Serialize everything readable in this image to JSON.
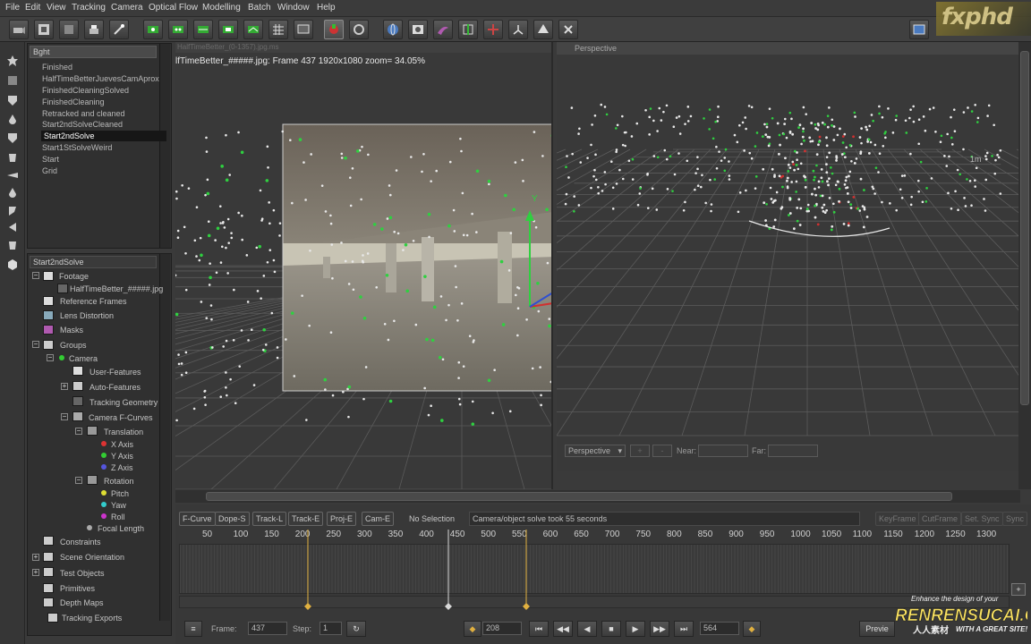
{
  "menu": [
    "File",
    "Edit",
    "View",
    "Tracking",
    "Camera",
    "Optical Flow",
    "Modelling",
    "Batch",
    "Window",
    "Help"
  ],
  "logo": "fxphd",
  "list_panel": {
    "header": "Bght",
    "items": [
      "Finished",
      "HalfTimeBetterJuevesCamAprox",
      "FinishedCleaningSolved",
      "FinishedCleaning",
      "Retracked and cleaned",
      "Start2ndSolveCleaned",
      "Start2ndSolve",
      "Start1StSolveWeird",
      "Start",
      "Grid"
    ],
    "selected": "Start2ndSolve"
  },
  "tree_panel": {
    "header": "Start2ndSolve",
    "items": {
      "footage": "Footage",
      "footage_file": "HalfTimeBetter_#####.jpg",
      "reference_frames": "Reference Frames",
      "lens_distortion": "Lens Distortion",
      "masks": "Masks",
      "groups": "Groups",
      "camera": "Camera",
      "user_features": "User-Features",
      "auto_features": "Auto-Features",
      "tracking_geometry": "Tracking Geometry",
      "camera_fcurves": "Camera F-Curves",
      "translation": "Translation",
      "x_axis": "X Axis",
      "y_axis": "Y Axis",
      "z_axis": "Z Axis",
      "rotation": "Rotation",
      "pitch": "Pitch",
      "yaw": "Yaw",
      "roll": "Roll",
      "focal_length": "Focal Length",
      "constraints": "Constraints",
      "scene_orientation": "Scene Orientation",
      "test_objects": "Test Objects",
      "primitives": "Primitives",
      "depth_maps": "Depth Maps",
      "tracking_exports": "Tracking Exports"
    }
  },
  "left_view": {
    "tab_title": "HalfTimeBetter_(0-1357).jpg.ms",
    "info": "lfTimeBetter_#####.jpg: Frame 437  1920x1080 zoom= 34.05%",
    "axis_label": "Y"
  },
  "right_view": {
    "title": "Perspective",
    "dropdown": "Perspective",
    "plus": "+",
    "minus": "-",
    "near_label": "Near:",
    "far_label": "Far:",
    "near_value": "",
    "far_value": "",
    "axis_label": "1m"
  },
  "timeline": {
    "buttons": [
      "F-Curve",
      "Dope-S",
      "Track-L",
      "Track-E",
      "Proj-E",
      "Cam-E"
    ],
    "selection": "No Selection",
    "solve_info": "Camera/object solve took 55 seconds",
    "right_buttons": [
      "KeyFrame",
      "CutFrame",
      "Set. Sync",
      "Sync"
    ],
    "ticks": [
      "50",
      "100",
      "150",
      "200",
      "250",
      "300",
      "350",
      "400",
      "450",
      "500",
      "550",
      "600",
      "650",
      "700",
      "750",
      "800",
      "850",
      "900",
      "950",
      "1000",
      "1050",
      "1100",
      "1150",
      "1200",
      "1250",
      "1300"
    ]
  },
  "transport": {
    "frame_label": "Frame:",
    "frame_value": "437",
    "step_label": "Step:",
    "step_value": "1",
    "start_value": "208",
    "end_value": "564",
    "preview_label": "Previe"
  },
  "watermark": {
    "line1": "Enhance the design of your",
    "line2": "RENRENSUCAI.COM",
    "line3": "人人素材",
    "line4": "WITH A GREAT SITE!"
  },
  "colors": {
    "green": "#2fd040",
    "white_pts": "#e8e8e8",
    "red": "#d03030",
    "accent_yellow": "#e0b040"
  }
}
